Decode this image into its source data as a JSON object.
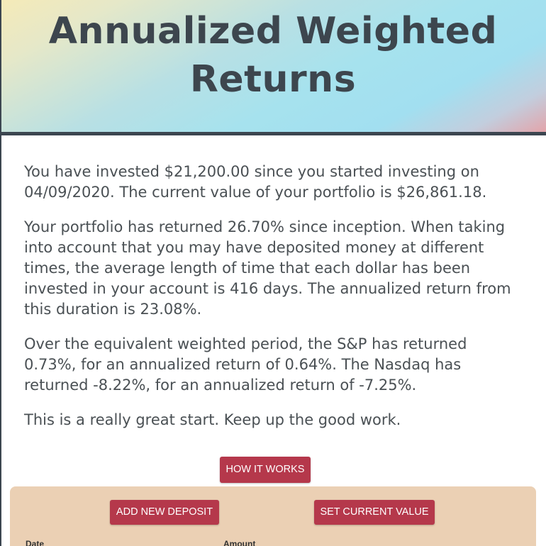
{
  "header": {
    "title": "Annualized Weighted Returns"
  },
  "summary": {
    "paragraphs": [
      "You have invested $21,200.00 since you started investing on 04/09/2020. The current value of your portfolio is $26,861.18.",
      "Your portfolio has returned 26.70% since inception. When taking into account that you may have deposited money at different times, the average length of time that each dollar has been invested in your account is 416 days. The annualized return from this duration is 23.08%.",
      "Over the equivalent weighted period, the S&P has returned 0.73%, for an annualized return of 0.64%. The Nasdaq has returned -8.22%, for an annualized return of -7.25%.",
      "This is a really great start. Keep up the good work."
    ]
  },
  "buttons": {
    "how_it_works": "HOW IT WORKS",
    "add_new_deposit": "ADD NEW DEPOSIT",
    "set_current_value": "SET CURRENT VALUE"
  },
  "deposits_table": {
    "columns": [
      "Date",
      "Amount"
    ]
  },
  "colors": {
    "accent": "#b5384b",
    "title_text": "#3d464e",
    "panel_background": "#ebd0b4"
  }
}
